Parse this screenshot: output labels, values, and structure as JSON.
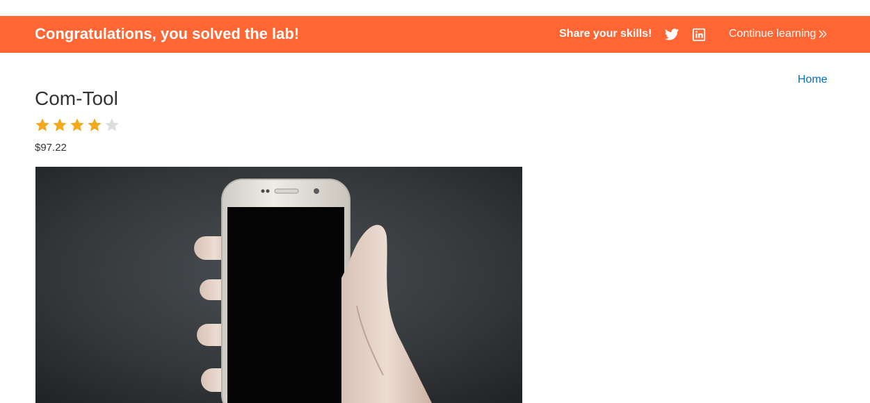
{
  "banner": {
    "title": "Congratulations, you solved the lab!",
    "share_label": "Share your skills!",
    "twitter_icon": "twitter-icon",
    "linkedin_icon": "linkedin-icon",
    "continue_label": "Continue learning",
    "continue_icon": "double-chevron-right-icon",
    "accent_color": "#ff6633"
  },
  "nav": {
    "home_label": "Home",
    "link_color": "#0071bc"
  },
  "product": {
    "title": "Com-Tool",
    "rating": 4,
    "rating_max": 5,
    "star_filled_color": "#f4a81c",
    "star_empty_color": "#dddddd",
    "price": "$97.22",
    "image": "hand-holding-smartphone-photo"
  }
}
